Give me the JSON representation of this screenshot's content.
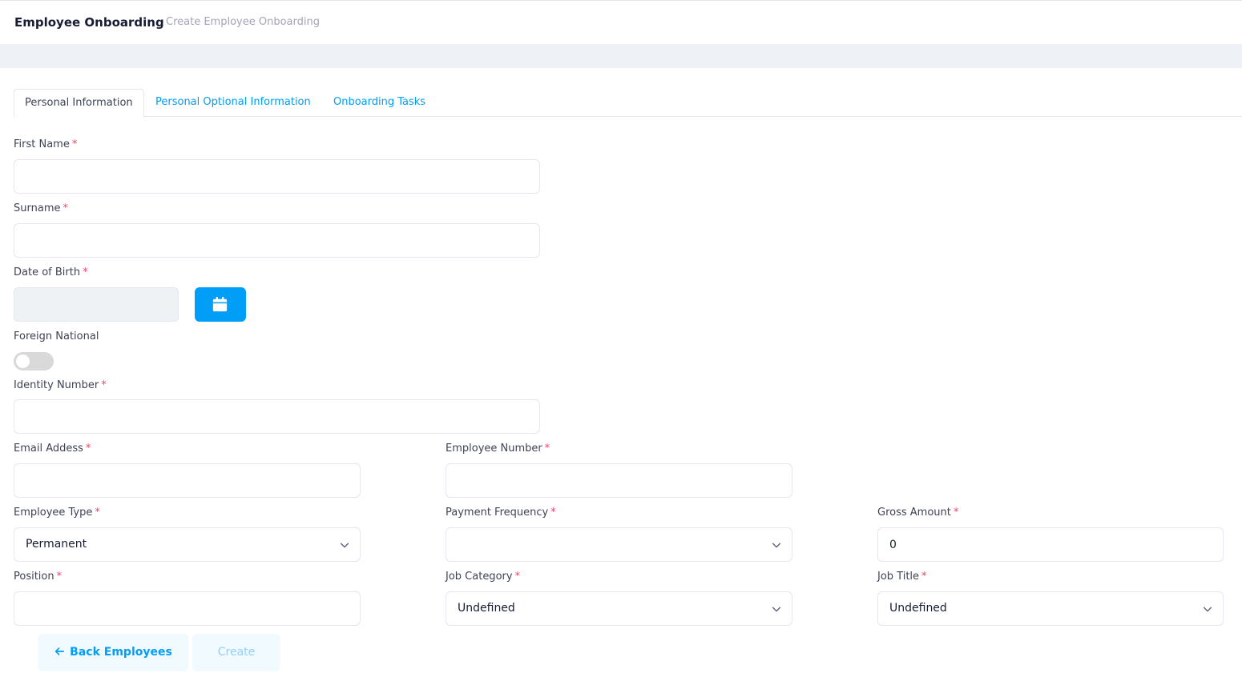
{
  "header": {
    "title": "Employee Onboarding",
    "subtitle": "Create Employee Onboarding"
  },
  "tabs": [
    {
      "label": "Personal Information",
      "active": true
    },
    {
      "label": "Personal Optional Information",
      "active": false
    },
    {
      "label": "Onboarding Tasks",
      "active": false
    }
  ],
  "form": {
    "first_name": {
      "label": "First Name",
      "value": ""
    },
    "surname": {
      "label": "Surname",
      "value": ""
    },
    "date_of_birth": {
      "label": "Date of Birth",
      "value": ""
    },
    "foreign_national": {
      "label": "Foreign National",
      "checked": false
    },
    "identity_number": {
      "label": "Identity Number",
      "value": ""
    },
    "email_address": {
      "label": "Email Addess",
      "value": ""
    },
    "employee_number": {
      "label": "Employee Number",
      "value": ""
    },
    "employee_type": {
      "label": "Employee Type",
      "value": "Permanent"
    },
    "payment_frequency": {
      "label": "Payment Frequency",
      "value": ""
    },
    "gross_amount": {
      "label": "Gross Amount",
      "value": "0"
    },
    "position": {
      "label": "Position",
      "value": ""
    },
    "job_category": {
      "label": "Job Category",
      "value": "Undefined"
    },
    "job_title": {
      "label": "Job Title",
      "value": "Undefined"
    },
    "required_marker": "*"
  },
  "actions": {
    "back_label": "Back Employees",
    "create_label": "Create"
  },
  "colors": {
    "accent": "#009ef7",
    "required": "#f1416c",
    "toggle_off": "#d9d9d9"
  },
  "icons": {
    "calendar": "calendar-icon",
    "chevron": "chevron-down-icon",
    "back": "arrow-left-icon"
  }
}
